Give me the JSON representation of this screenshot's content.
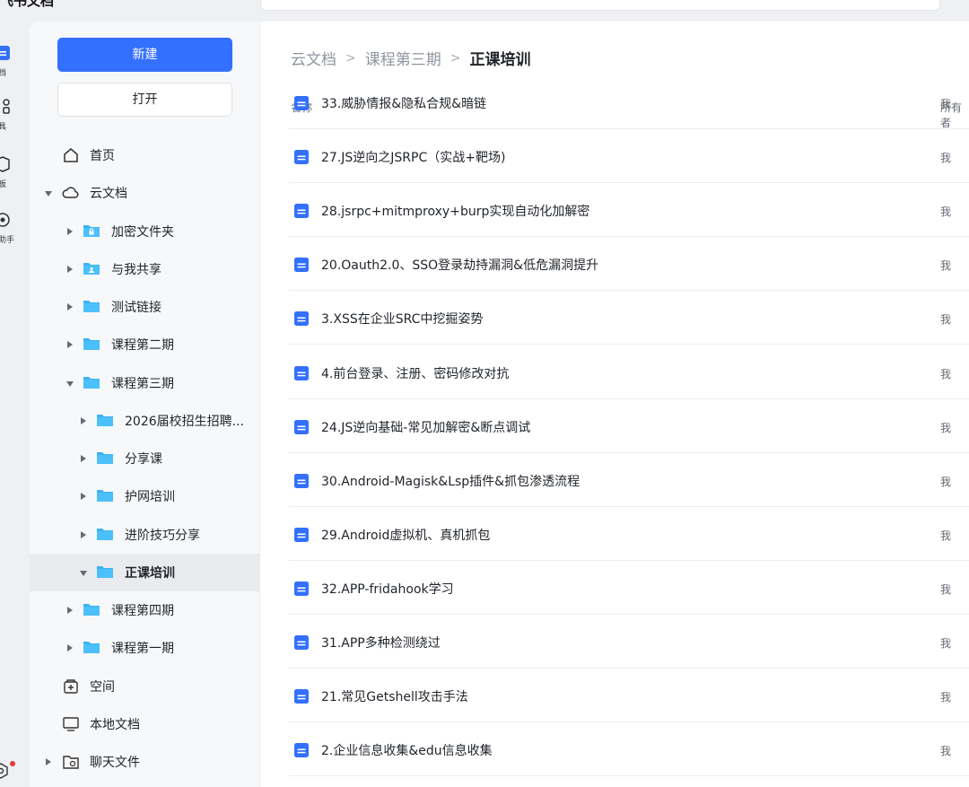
{
  "app": {
    "title": "飞书文档"
  },
  "rail": {
    "items": [
      {
        "label": "档",
        "icon": "doc-icon"
      },
      {
        "label": "具",
        "icon": "tools-icon"
      },
      {
        "label": "板",
        "icon": "template-icon"
      },
      {
        "label": "助手",
        "icon": "assistant-icon"
      }
    ]
  },
  "sidebar": {
    "new_label": "新建",
    "open_label": "打开",
    "items": [
      {
        "label": "首页",
        "icon": "home-icon",
        "level": 0,
        "caret": "none"
      },
      {
        "label": "云文档",
        "icon": "cloud-icon",
        "level": 0,
        "caret": "down"
      },
      {
        "label": "加密文件夹",
        "icon": "lock-folder-icon",
        "level": 1,
        "caret": "right"
      },
      {
        "label": "与我共享",
        "icon": "shared-folder-icon",
        "level": 1,
        "caret": "right"
      },
      {
        "label": "测试链接",
        "icon": "folder-icon",
        "level": 1,
        "caret": "right"
      },
      {
        "label": "课程第二期",
        "icon": "folder-icon",
        "level": 1,
        "caret": "right"
      },
      {
        "label": "课程第三期",
        "icon": "folder-icon",
        "level": 1,
        "caret": "down"
      },
      {
        "label": "2026届校招生招聘...",
        "icon": "folder-icon",
        "level": 2,
        "caret": "right"
      },
      {
        "label": "分享课",
        "icon": "folder-icon",
        "level": 2,
        "caret": "right"
      },
      {
        "label": "护网培训",
        "icon": "folder-icon",
        "level": 2,
        "caret": "right"
      },
      {
        "label": "进阶技巧分享",
        "icon": "folder-icon",
        "level": 2,
        "caret": "right"
      },
      {
        "label": "正课培训",
        "icon": "folder-icon",
        "level": 2,
        "caret": "down",
        "selected": true
      },
      {
        "label": "课程第四期",
        "icon": "folder-icon",
        "level": 1,
        "caret": "right"
      },
      {
        "label": "课程第一期",
        "icon": "folder-icon",
        "level": 1,
        "caret": "right"
      },
      {
        "label": "空间",
        "icon": "space-icon",
        "level": 0,
        "caret": "none"
      },
      {
        "label": "本地文档",
        "icon": "monitor-icon",
        "level": 0,
        "caret": "none"
      },
      {
        "label": "聊天文件",
        "icon": "chat-folder-icon",
        "level": 0,
        "caret": "right"
      }
    ]
  },
  "breadcrumb": [
    "云文档",
    "课程第三期",
    "正课培训"
  ],
  "columns": {
    "name": "名称",
    "owner": "所有者"
  },
  "files": [
    {
      "title": "33.威胁情报&隐私合规&暗链",
      "owner": "我"
    },
    {
      "title": "27.JS逆向之JSRPC（实战+靶场)",
      "owner": "我"
    },
    {
      "title": "28.jsrpc+mitmproxy+burp实现自动化加解密",
      "owner": "我"
    },
    {
      "title": "20.Oauth2.0、SSO登录劫持漏洞&低危漏洞提升",
      "owner": "我"
    },
    {
      "title": "3.XSS在企业SRC中挖掘姿势",
      "owner": "我"
    },
    {
      "title": "4.前台登录、注册、密码修改对抗",
      "owner": "我"
    },
    {
      "title": "24.JS逆向基础-常见加解密&断点调试",
      "owner": "我"
    },
    {
      "title": "30.Android-Magisk&Lsp插件&抓包渗透流程",
      "owner": "我"
    },
    {
      "title": "29.Android虚拟机、真机抓包",
      "owner": "我"
    },
    {
      "title": "32.APP-fridahook学习",
      "owner": "我"
    },
    {
      "title": "31.APP多种检测绕过",
      "owner": "我"
    },
    {
      "title": "21.常见Getshell攻击手法",
      "owner": "我"
    },
    {
      "title": "2.企业信息收集&edu信息收集",
      "owner": "我"
    }
  ],
  "colors": {
    "accent": "#3370ff",
    "folder": "#3ab2f4",
    "doc": "#3370ff"
  }
}
